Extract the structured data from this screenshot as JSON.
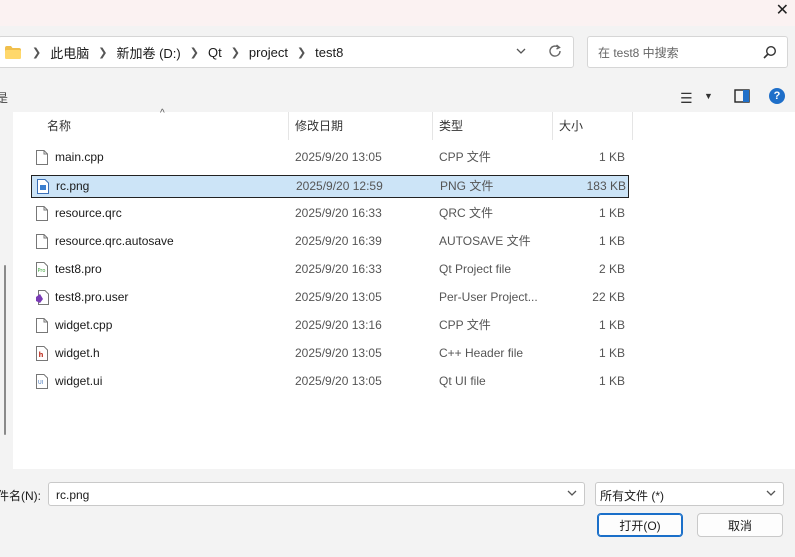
{
  "titlebar": {
    "close_icon": "close-icon"
  },
  "address": {
    "breadcrumbs": [
      "此电脑",
      "新加卷 (D:)",
      "Qt",
      "project",
      "test8"
    ]
  },
  "search": {
    "placeholder": "在 test8 中搜索"
  },
  "left_clipped_text": "是",
  "columns": {
    "name": "名称",
    "date": "修改日期",
    "type": "类型",
    "size": "大小"
  },
  "files": [
    {
      "name": "main.cpp",
      "date": "2025/9/20 13:05",
      "type": "CPP 文件",
      "size": "1 KB",
      "icon": "file-icon",
      "selected": false
    },
    {
      "name": "rc.png",
      "date": "2025/9/20 12:59",
      "type": "PNG 文件",
      "size": "183 KB",
      "icon": "image-file-icon",
      "selected": true
    },
    {
      "name": "resource.qrc",
      "date": "2025/9/20 16:33",
      "type": "QRC 文件",
      "size": "1 KB",
      "icon": "file-icon",
      "selected": false
    },
    {
      "name": "resource.qrc.autosave",
      "date": "2025/9/20 16:39",
      "type": "AUTOSAVE 文件",
      "size": "1 KB",
      "icon": "file-icon",
      "selected": false
    },
    {
      "name": "test8.pro",
      "date": "2025/9/20 16:33",
      "type": "Qt Project file",
      "size": "2 KB",
      "icon": "qt-pro-file-icon",
      "selected": false
    },
    {
      "name": "test8.pro.user",
      "date": "2025/9/20 13:05",
      "type": "Per-User Project...",
      "size": "22 KB",
      "icon": "vs-user-file-icon",
      "selected": false
    },
    {
      "name": "widget.cpp",
      "date": "2025/9/20 13:16",
      "type": "CPP 文件",
      "size": "1 KB",
      "icon": "file-icon",
      "selected": false
    },
    {
      "name": "widget.h",
      "date": "2025/9/20 13:05",
      "type": "C++ Header file",
      "size": "1 KB",
      "icon": "header-file-icon",
      "selected": false
    },
    {
      "name": "widget.ui",
      "date": "2025/9/20 13:05",
      "type": "Qt UI file",
      "size": "1 KB",
      "icon": "ui-file-icon",
      "selected": false
    }
  ],
  "footer": {
    "filename_label": "件名(N):",
    "filename_value": "rc.png",
    "filter_value": "所有文件 (*)",
    "open_label": "打开(O)",
    "cancel_label": "取消"
  },
  "colors": {
    "selection": "#cce4f7",
    "accent": "#1a6fc9"
  }
}
